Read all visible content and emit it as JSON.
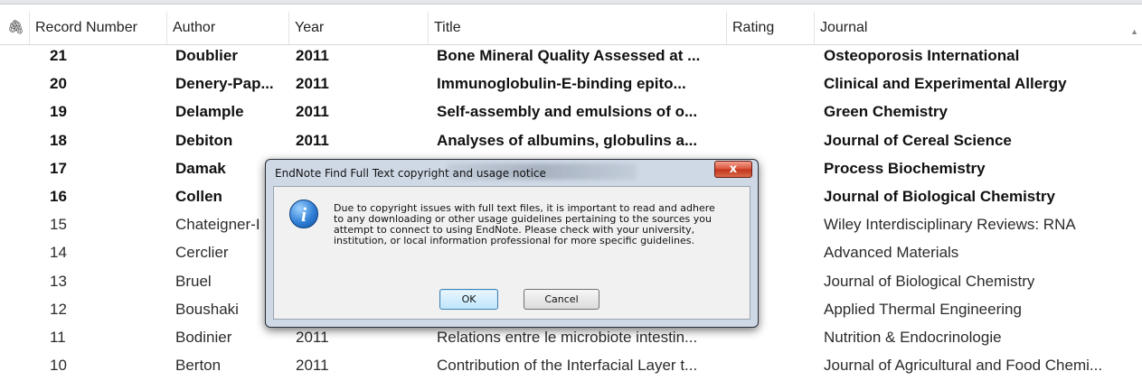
{
  "columns": [
    {
      "key": "attach",
      "label": ""
    },
    {
      "key": "record",
      "label": "Record Number"
    },
    {
      "key": "author",
      "label": "Author"
    },
    {
      "key": "year",
      "label": "Year"
    },
    {
      "key": "title",
      "label": "Title"
    },
    {
      "key": "rating",
      "label": "Rating"
    },
    {
      "key": "journal",
      "label": "Journal"
    }
  ],
  "rows": [
    {
      "record": "21",
      "author": "Doublier",
      "year": "2011",
      "title": "Bone Mineral Quality Assessed at ...",
      "journal": "Osteoporosis International",
      "unread": true
    },
    {
      "record": "20",
      "author": "Denery-Pap...",
      "year": "2011",
      "title": "Immunoglobulin-E-binding epito...",
      "journal": "Clinical and Experimental Allergy",
      "unread": true
    },
    {
      "record": "19",
      "author": "Delample",
      "year": "2011",
      "title": "Self-assembly and emulsions of o...",
      "journal": "Green Chemistry",
      "unread": true
    },
    {
      "record": "18",
      "author": "Debiton",
      "year": "2011",
      "title": "Analyses of albumins, globulins a...",
      "journal": "Journal of Cereal Science",
      "unread": true
    },
    {
      "record": "17",
      "author": "Damak",
      "year": "",
      "title": "",
      "journal": "Process Biochemistry",
      "unread": true
    },
    {
      "record": "16",
      "author": "Collen",
      "year": "",
      "title": "",
      "journal": "Journal of Biological Chemistry",
      "unread": true
    },
    {
      "record": "15",
      "author": "Chateigner-I",
      "year": "",
      "title": "",
      "journal": "Wiley Interdisciplinary Reviews: RNA",
      "unread": false
    },
    {
      "record": "14",
      "author": "Cerclier",
      "year": "",
      "title": "",
      "journal": "Advanced Materials",
      "unread": false
    },
    {
      "record": "13",
      "author": "Bruel",
      "year": "",
      "title": "",
      "journal": "Journal of Biological Chemistry",
      "unread": false
    },
    {
      "record": "12",
      "author": "Boushaki",
      "year": "",
      "title": "",
      "journal": "Applied Thermal Engineering",
      "unread": false
    },
    {
      "record": "11",
      "author": "Bodinier",
      "year": "2011",
      "title": "Relations entre le microbiote intestin...",
      "journal": "Nutrition & Endocrinologie",
      "unread": false
    },
    {
      "record": "10",
      "author": "Berton",
      "year": "2011",
      "title": "Contribution of the Interfacial Layer t...",
      "journal": "Journal of Agricultural and Food Chemi...",
      "unread": false
    }
  ],
  "dialog": {
    "title": "EndNote Find Full Text copyright and usage notice",
    "close_label": "x",
    "icon": "info-icon",
    "message": "Due to copyright issues with full text files, it is important to read and adhere\nto any downloading or other usage guidelines pertaining to the sources you\nattempt to connect to using EndNote. Please check with your university,\ninstitution, or local information professional for more specific guidelines.",
    "ok_label": "OK",
    "cancel_label": "Cancel"
  },
  "icons": {
    "attach": "paperclip-icon"
  }
}
